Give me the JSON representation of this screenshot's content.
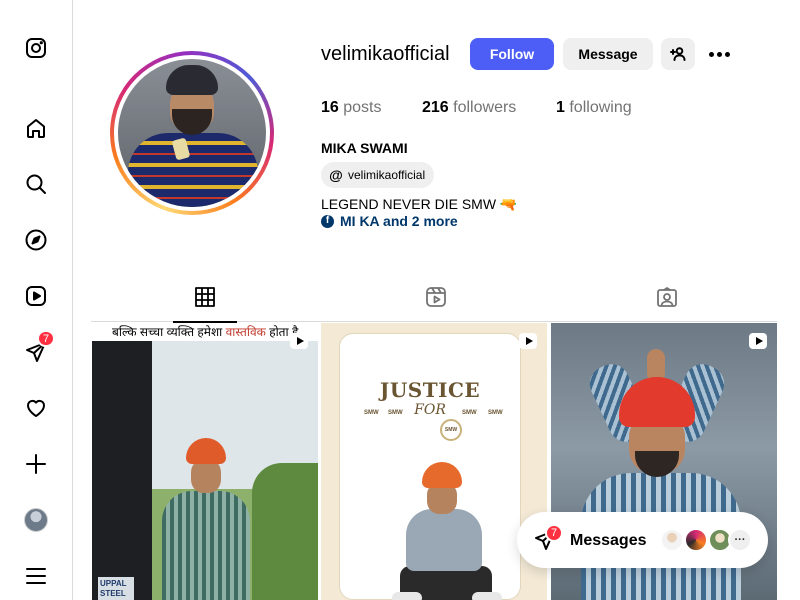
{
  "sidebar": {
    "items": [
      {
        "name": "instagram-logo"
      },
      {
        "name": "home"
      },
      {
        "name": "search"
      },
      {
        "name": "explore"
      },
      {
        "name": "reels"
      },
      {
        "name": "messages",
        "badge": "7"
      },
      {
        "name": "notifications"
      },
      {
        "name": "create"
      },
      {
        "name": "profile"
      },
      {
        "name": "more"
      }
    ]
  },
  "profile": {
    "username": "velimikaofficial",
    "follow_label": "Follow",
    "message_label": "Message",
    "stats": {
      "posts_count": "16",
      "posts_label": "posts",
      "followers_count": "216",
      "followers_label": "followers",
      "following_count": "1",
      "following_label": "following"
    },
    "full_name": "MIKA SWAMI",
    "threads_handle": "velimikaofficial",
    "bio": "LEGEND NEVER DIE SMW 🔫",
    "links_text": "MI KA and 2 more"
  },
  "tabs": [
    {
      "name": "posts",
      "active": true
    },
    {
      "name": "reels",
      "active": false
    },
    {
      "name": "tagged",
      "active": false
    }
  ],
  "posts": {
    "p1_caption_pre": "बल्कि सच्चा व्यक्ति हमेशा ",
    "p1_caption_hl": "वास्तविक",
    "p1_caption_post": " होता है",
    "p1_banner": "UPPAL STEEL",
    "p2_title": "JUSTICE",
    "p2_for": "FOR",
    "p2_small": "SMW",
    "p2_seal": "SMW"
  },
  "messages": {
    "label": "Messages",
    "badge": "7",
    "more_label": "···"
  },
  "colors": {
    "follow_button": "#4c5ef5",
    "badge": "#ff3040",
    "link": "#00376b"
  }
}
